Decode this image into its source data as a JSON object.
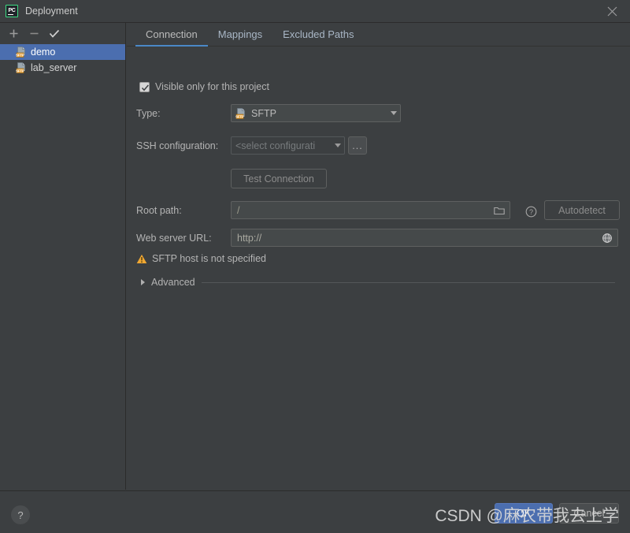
{
  "window": {
    "title": "Deployment",
    "app_icon": "pycharm-logo",
    "app_icon_text": "PC",
    "close_icon": "close-icon",
    "accent_blue": "#4b6eaf",
    "tab_underline": "#4a88c7",
    "warning_color": "#f0a732",
    "background": "#3c3f41"
  },
  "sidebar": {
    "toolbar": [
      {
        "name": "add-server-button",
        "icon": "plus-icon",
        "label": "+"
      },
      {
        "name": "remove-server-button",
        "icon": "minus-icon",
        "label": "−"
      },
      {
        "name": "set-default-server-button",
        "icon": "check-icon",
        "label": "✓"
      }
    ],
    "servers": [
      {
        "label": "demo",
        "icon": "sftp-icon",
        "selected": true
      },
      {
        "label": "lab_server",
        "icon": "sftp-icon",
        "selected": false
      }
    ]
  },
  "tabs": [
    {
      "label": "Connection",
      "active": true
    },
    {
      "label": "Mappings",
      "active": false
    },
    {
      "label": "Excluded Paths",
      "active": false
    }
  ],
  "form": {
    "visible_only_checkbox": {
      "label": "Visible only for this project",
      "checked": true
    },
    "type": {
      "label": "Type:",
      "value": "SFTP",
      "icon": "sftp-icon"
    },
    "ssh_configuration": {
      "label": "SSH configuration:",
      "value": "<select configurati",
      "browse_button": "..."
    },
    "test_connection_button": {
      "label": "Test Connection",
      "enabled": false
    },
    "root_path": {
      "label": "Root path:",
      "value": "/",
      "folder_icon": "folder-icon",
      "help_icon": "question-circle-icon",
      "autodetect_button": "Autodetect"
    },
    "web_server_url": {
      "label": "Web server URL:",
      "value": "http://",
      "globe_icon": "globe-icon"
    },
    "warning": {
      "icon": "warning-triangle-icon",
      "text": "SFTP host is not specified"
    },
    "advanced": {
      "label": "Advanced",
      "expanded": false,
      "icon": "chevron-right-icon"
    }
  },
  "footer": {
    "help_button": {
      "label": "?",
      "icon": "question-icon"
    },
    "ok_button": "OK",
    "cancel_button": "Cancel"
  },
  "watermark": "CSDN @麻农带我去上学"
}
